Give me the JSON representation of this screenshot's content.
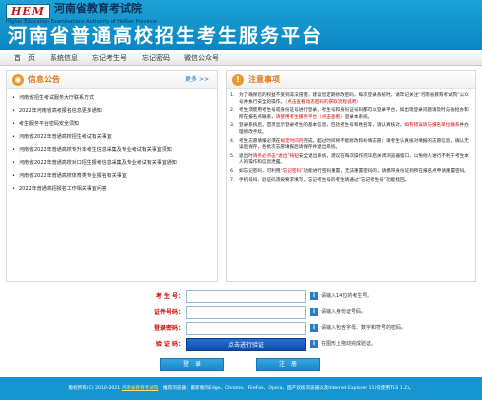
{
  "header": {
    "logo_text": "HEM",
    "authority": "河南省教育考试院",
    "authority_en": "Higher Education Examinations Authority of HeNan Province",
    "title": "河南省普通高校招生考生服务平台"
  },
  "nav": [
    "首　页",
    "系统信息",
    "忘记考生号",
    "忘记密码",
    "微信公众号"
  ],
  "announcements": {
    "title": "信息公告",
    "more": "更多 >>",
    "bullet": "•",
    "items": [
      "河南省招生考试服务大厅联系方式",
      "2022年河南省高考报名信息更多通知",
      "考生服务平台密码安全须知",
      "河南省2022年普通高校招生考试有关事宜",
      "河南省2022年普通高校专升本考生信息采集及专业考试有关事宜须知",
      "河南省2022年普通高校对口招生报考信息采集及专业考试有关事宜通知",
      "河南省2022年普通高校体育类专业报名有关事宜",
      "2022年普通高招报名工作相关事宜问答"
    ]
  },
  "notice": {
    "title": "注意事项",
    "items": [
      {
        "n": "1.",
        "a": "为了确保您的权益不受到非法侵害，建议您定期修改密码，每次登录系统时，请牢记关注“河南省教育考试院”公众号并执行安全的操作。",
        "r": "（点击查看动态密码的获取流程说明）",
        "b": ""
      },
      {
        "n": "2.",
        "a": "考生须使用考生号或身份证号进行登录，考生号和身份证号码都可以登录平台，如出现登录问题请及时与省招办和所在报名点联系，",
        "r": "请使用考生服务平台（点击查看）",
        "b": "登录本系统。"
      },
      {
        "n": "3.",
        "a": "登录系统后，首页显示登录考生的基本信息，包括考生号和姓名等，请认真核对，",
        "r": "如有错误请与报名单位联系",
        "b": "并办理修改手续。"
      },
      {
        "n": "4.",
        "a": "考生志愿填报必须在",
        "r": "规定时间内",
        "b": "完成，超过时间将不能修改和补填志愿；请考生认真核对填报的志愿信息，确认无误后保存，各批次志愿填报后请保存并退出系统。"
      },
      {
        "n": "5.",
        "a": "退出时",
        "r": "请务必点击“退出”按钮",
        "b": "安全退出系统，建议在每次操作完毕后关闭浏览器窗口，以免他人进行不利于考生本人的操作和信息泄露。"
      },
      {
        "n": "6.",
        "a": "如忘记密码，可利用",
        "r": "“忘记密码”",
        "b": "功能进行密码重置，无法重置密码的，请携带身份证到所在报名点申请重置密码。"
      },
      {
        "n": "7.",
        "a": "手机号码、验证码须按要求填写，忘记考生号的考生请通过“忘记考生号”功能找回。",
        "r": "",
        "b": ""
      }
    ]
  },
  "login": {
    "exam_no_label": "考 生 号：",
    "exam_no_hint": "请输入14位的考生号。",
    "id_label": "证件号码：",
    "id_hint": "请输入身份证号码。",
    "pwd_label": "登录密码：",
    "pwd_hint": "请输入包含字母、数字和符号的密码。",
    "captcha_label": "验 证 码：",
    "captcha_btn": "点击进行验证",
    "captcha_hint": "在图形上拖动完成验证。",
    "hint_icon": "i",
    "login_btn": "登　录",
    "register_btn": "注　册"
  },
  "footer": {
    "before": "版权所有(C) 2010-2021 ",
    "link": "河南省教育考试院",
    "after": "　推荐浏览器：最新版的Edge、Chrome、FireFox、Opera、国产双核浏览器以及Internet Explorer 11(仅使用TLS 1.2)。"
  }
}
